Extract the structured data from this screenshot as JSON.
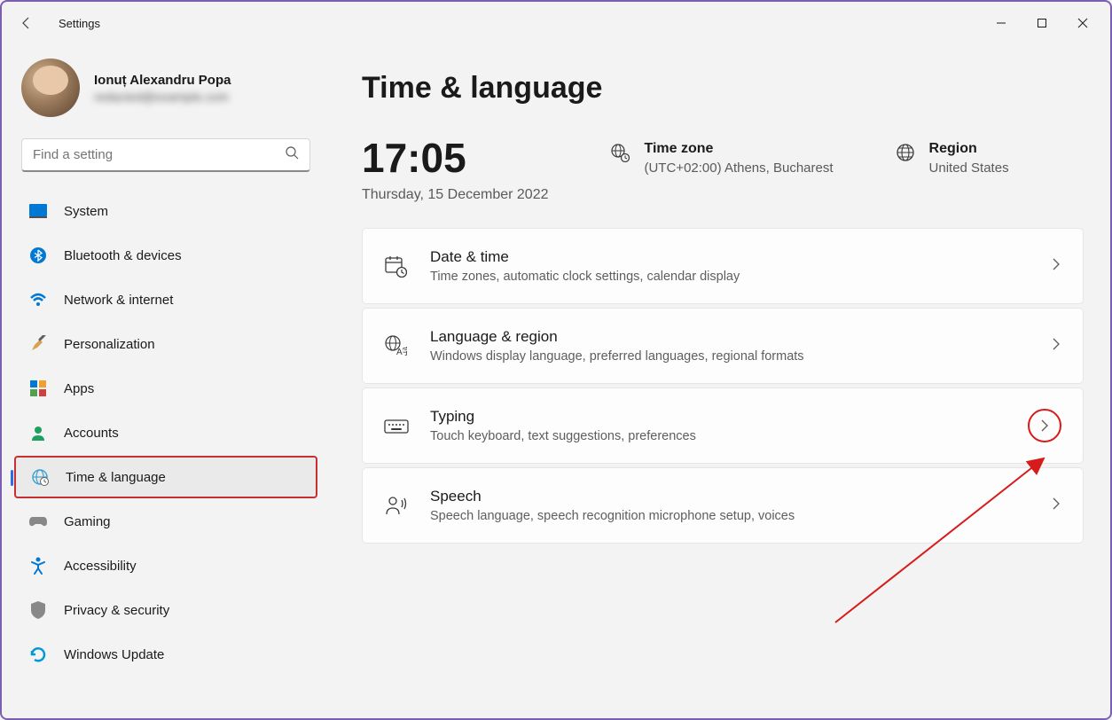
{
  "app": {
    "title": "Settings"
  },
  "user": {
    "name": "Ionuț Alexandru Popa",
    "email": "redacted@example.com"
  },
  "search": {
    "placeholder": "Find a setting"
  },
  "sidebar": {
    "items": [
      {
        "label": "System"
      },
      {
        "label": "Bluetooth & devices"
      },
      {
        "label": "Network & internet"
      },
      {
        "label": "Personalization"
      },
      {
        "label": "Apps"
      },
      {
        "label": "Accounts"
      },
      {
        "label": "Time & language"
      },
      {
        "label": "Gaming"
      },
      {
        "label": "Accessibility"
      },
      {
        "label": "Privacy & security"
      },
      {
        "label": "Windows Update"
      }
    ]
  },
  "page": {
    "title": "Time & language",
    "clock": {
      "time": "17:05",
      "date": "Thursday, 15 December 2022"
    },
    "timezone": {
      "label": "Time zone",
      "value": "(UTC+02:00) Athens, Bucharest"
    },
    "region": {
      "label": "Region",
      "value": "United States"
    },
    "cards": [
      {
        "title": "Date & time",
        "sub": "Time zones, automatic clock settings, calendar display"
      },
      {
        "title": "Language & region",
        "sub": "Windows display language, preferred languages, regional formats"
      },
      {
        "title": "Typing",
        "sub": "Touch keyboard, text suggestions, preferences"
      },
      {
        "title": "Speech",
        "sub": "Speech language, speech recognition microphone setup, voices"
      }
    ]
  }
}
